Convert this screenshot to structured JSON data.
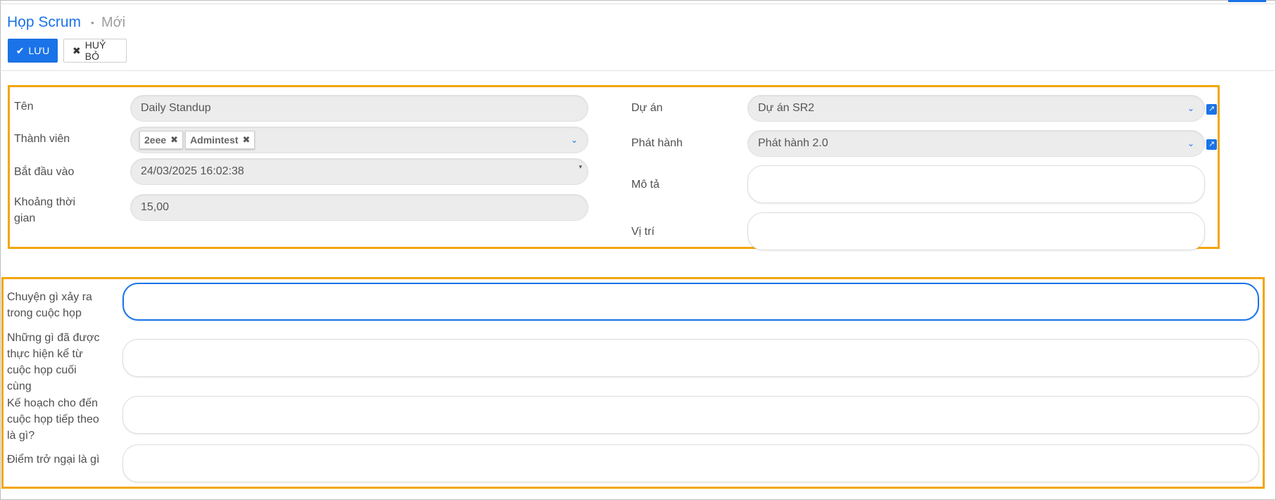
{
  "header": {
    "breadcrumb_link": "Họp Scrum",
    "breadcrumb_separator": "•",
    "breadcrumb_current": "Mới"
  },
  "toolbar": {
    "save_icon": "check-icon",
    "save_label": "LƯU",
    "cancel_icon": "close-icon",
    "cancel_label": "HUỶ BỎ"
  },
  "form": {
    "name": {
      "label": "Tên",
      "value": "Daily Standup"
    },
    "members": {
      "label": "Thành viên",
      "tags": [
        {
          "label": "2eee"
        },
        {
          "label": "Admintest"
        }
      ]
    },
    "start": {
      "label": "Bắt đầu vào",
      "value": "24/03/2025 16:02:38"
    },
    "duration": {
      "label": "Khoảng thời gian",
      "value": "15,00"
    },
    "project": {
      "label": "Dự án",
      "value": "Dự án SR2"
    },
    "release": {
      "label": "Phát hành",
      "value": "Phát hành 2.0"
    },
    "description": {
      "label": "Mô tả",
      "value": ""
    },
    "location": {
      "label": "Vị trí",
      "value": ""
    }
  },
  "notes": {
    "q1": {
      "label": "Chuyện gì xảy ra trong cuộc họp",
      "value": ""
    },
    "q2": {
      "label": "Những gì đã được thực hiện kể từ cuộc họp cuối cùng",
      "value": ""
    },
    "q3": {
      "label": "Kế hoạch cho đến cuộc họp tiếp theo là gì?",
      "value": ""
    },
    "q4": {
      "label": "Điểm trở ngại là gì",
      "value": ""
    }
  },
  "colors": {
    "accent": "#1a73e8",
    "highlight_border": "#f2a60c"
  }
}
